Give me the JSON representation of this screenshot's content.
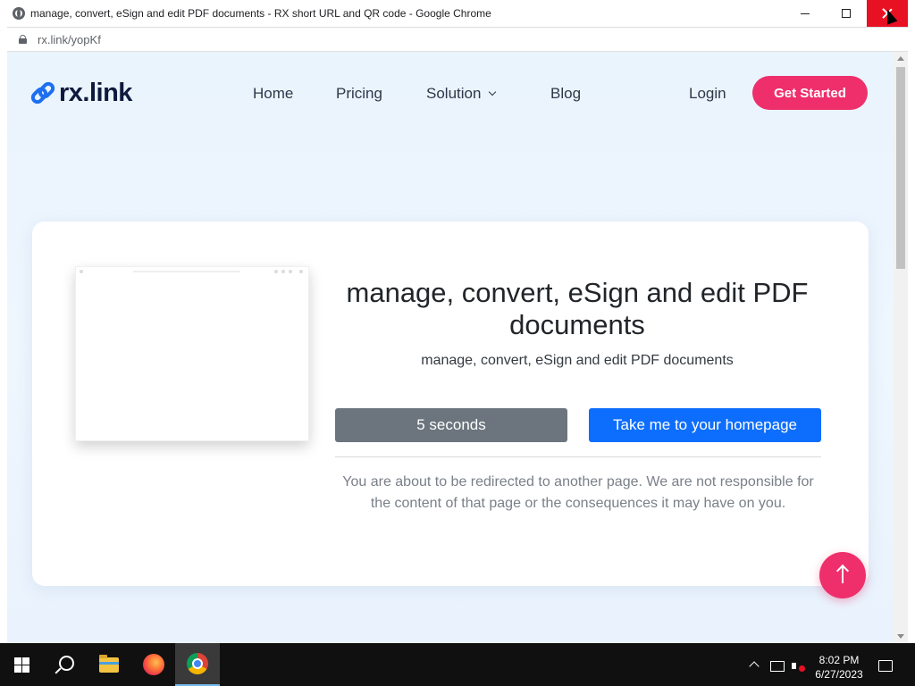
{
  "browser": {
    "window_title": "manage, convert, eSign and edit PDF documents - RX short URL and QR code - Google Chrome",
    "url": "rx.link/yopKf"
  },
  "site": {
    "logo_text": "rx.link",
    "nav": {
      "home": "Home",
      "pricing": "Pricing",
      "solution": "Solution",
      "blog": "Blog",
      "login": "Login",
      "get_started": "Get Started"
    }
  },
  "card": {
    "title": "manage, convert, eSign and edit PDF documents",
    "subtitle": "manage, convert, eSign and edit PDF documents",
    "countdown_label": "5 seconds",
    "homepage_button": "Take me to your homepage",
    "disclaimer": "You are about to be redirected to another page. We are not responsible for the content of that page or the consequences it may have on you."
  },
  "taskbar": {
    "time": "8:02 PM",
    "date": "6/27/2023",
    "active_app": "chrome"
  },
  "colors": {
    "accent_pink": "#ee2f6b",
    "primary_blue": "#0d6efd",
    "secondary_gray": "#6c757d",
    "logo_navy": "#0f1a3d"
  },
  "icons": [
    "globe-icon",
    "lock-icon",
    "link-icon",
    "chevron-down-icon",
    "arrow-up-icon",
    "windows-start-icon",
    "search-icon",
    "file-explorer-icon",
    "firefox-icon",
    "chrome-icon",
    "network-icon",
    "volume-muted-icon",
    "notifications-icon"
  ]
}
